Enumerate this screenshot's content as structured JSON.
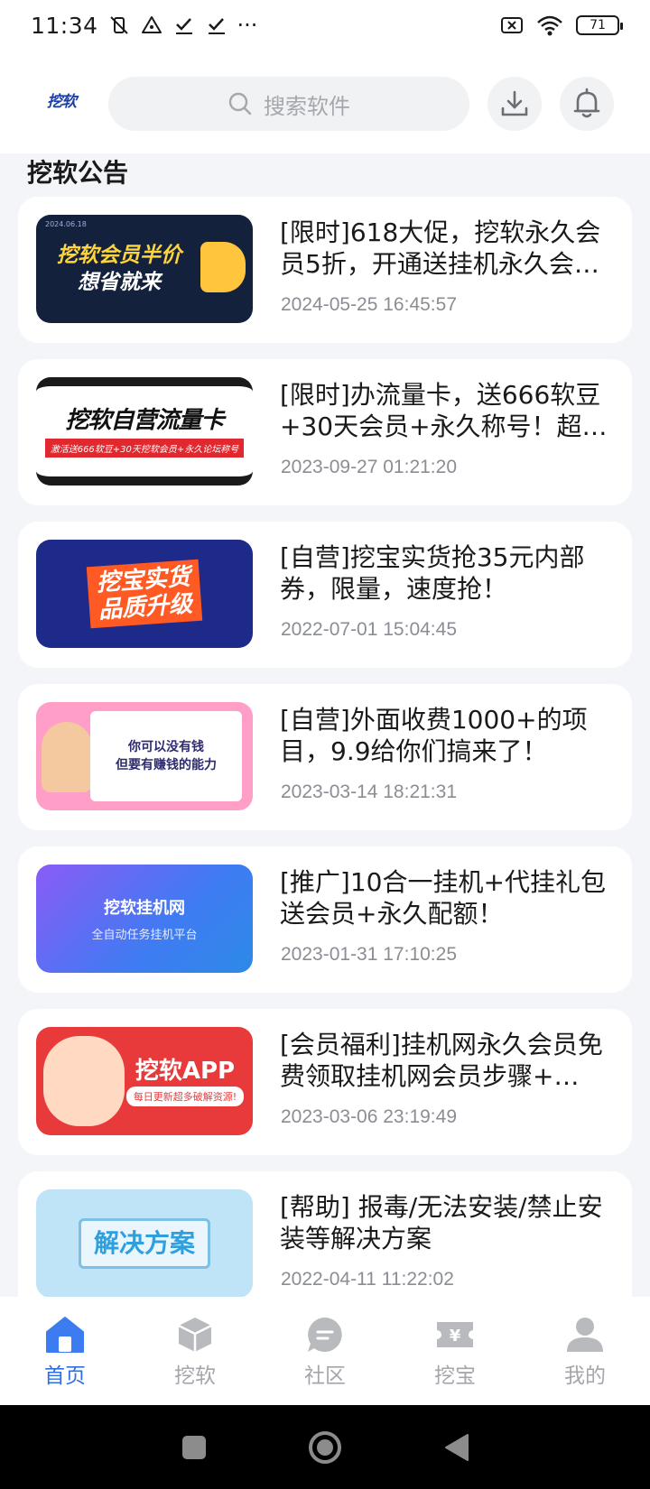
{
  "status_bar": {
    "time": "11:34",
    "extra": "···",
    "battery": "71"
  },
  "header": {
    "logo_text": "挖软",
    "search_placeholder": "搜索软件"
  },
  "section": {
    "title": "挖软公告"
  },
  "announcements": [
    {
      "title": "[限时]618大促，挖软永久会员5折，开通送挂机永久会…",
      "date": "2024-05-25 16:45:57",
      "thumb_text": "挖软会员半价",
      "thumb_text2": "想省就来",
      "thumb_strip": "2024.06.18"
    },
    {
      "title": "[限时]办流量卡，送666软豆+30天会员+永久称号！超…",
      "date": "2023-09-27 01:21:20",
      "thumb_text": "挖软自营流量卡",
      "thumb_sub": "激活送666软豆+30天挖软会员+永久论坛称号"
    },
    {
      "title": "[自营]挖宝实货抢35元内部券，限量，速度抢！",
      "date": "2022-07-01 15:04:45",
      "thumb_text": "挖宝实货",
      "thumb_text2": "品质升级"
    },
    {
      "title": "[自营]外面收费1000+的项目，9.9给你们搞来了！",
      "date": "2023-03-14 18:21:31",
      "thumb_text": "你可以没有钱",
      "thumb_text2": "但要有赚钱的能力"
    },
    {
      "title": "[推广]10合一挂机+代挂礼包送会员+永久配额！",
      "date": "2023-01-31 17:10:25",
      "thumb_text": "挖软挂机网",
      "thumb_sub": "全自动任务挂机平台"
    },
    {
      "title": "[会员福利]挂机网永久会员免费领取挂机网会员步骤+…",
      "date": "2023-03-06 23:19:49",
      "thumb_text": "挖软APP",
      "thumb_sub": "每日更新超多破解资源!"
    },
    {
      "title": "[帮助] 报毒/无法安装/禁止安装等解决方案",
      "date": "2022-04-11 11:22:02",
      "thumb_text": "解决方案"
    }
  ],
  "tabs": [
    {
      "label": "首页",
      "icon": "home-icon"
    },
    {
      "label": "挖软",
      "icon": "box-icon"
    },
    {
      "label": "社区",
      "icon": "chat-icon"
    },
    {
      "label": "挖宝",
      "icon": "ticket-icon"
    },
    {
      "label": "我的",
      "icon": "user-icon"
    }
  ],
  "colors": {
    "accent": "#2f6fe4",
    "inactive": "#a4a6ab",
    "background": "#f4f5f9"
  }
}
